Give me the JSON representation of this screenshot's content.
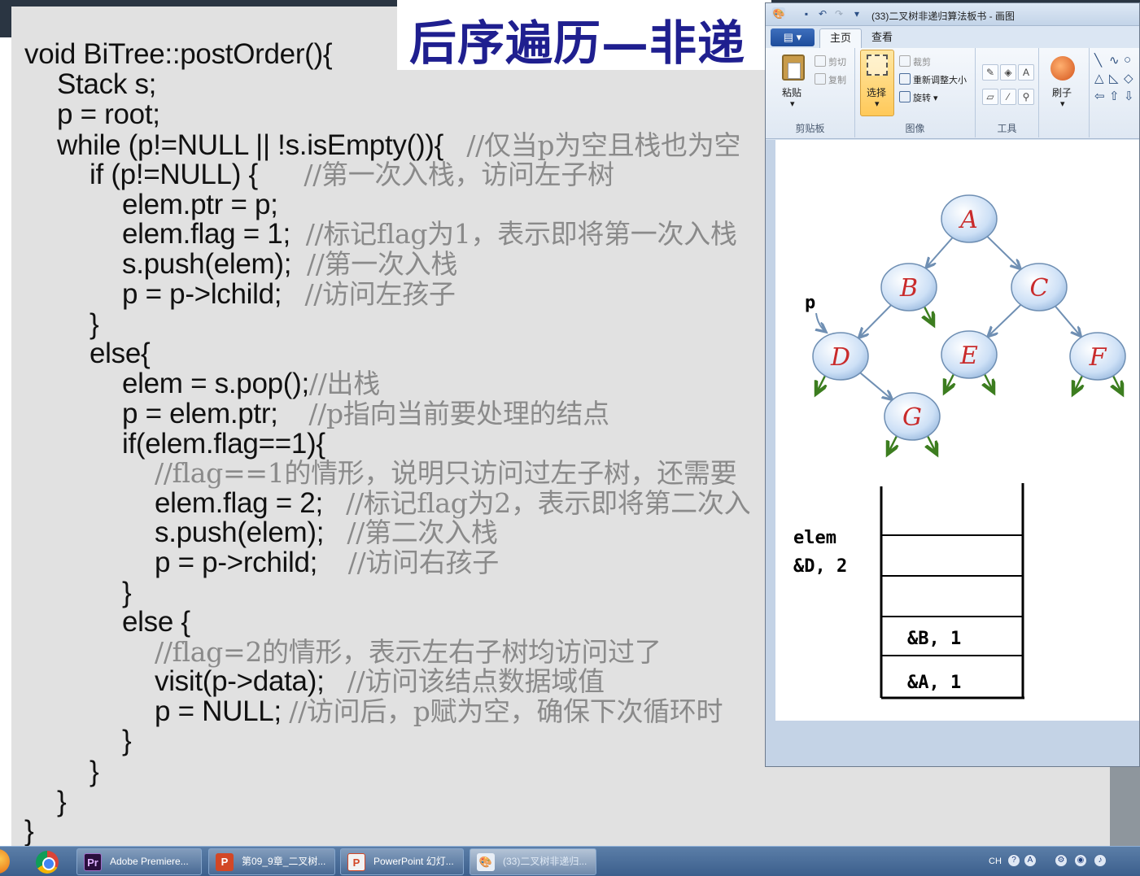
{
  "slide": {
    "title": "后序遍历—非递",
    "code_lines": [
      {
        "code": "void BiTree::postOrder(){",
        "comment": ""
      },
      {
        "code": "Stack s;",
        "comment": ""
      },
      {
        "code": "p = root;",
        "comment": ""
      },
      {
        "code": "while (p!=NULL || !s.isEmpty()){   ",
        "comment": "//仅当p为空且栈也为空"
      },
      {
        "code": "if (p!=NULL) {      ",
        "comment": "//第一次入栈，访问左子树"
      },
      {
        "code": "elem.ptr = p;",
        "comment": ""
      },
      {
        "code": "elem.flag = 1;  ",
        "comment": "//标记flag为1，表示即将第一次入栈"
      },
      {
        "code": "s.push(elem);  ",
        "comment": "//第一次入栈"
      },
      {
        "code": "p = p->lchild;   ",
        "comment": "//访问左孩子"
      },
      {
        "code": "}",
        "comment": ""
      },
      {
        "code": "else{",
        "comment": ""
      },
      {
        "code": "elem = s.pop();",
        "comment": "//出栈"
      },
      {
        "code": "p = elem.ptr;    ",
        "comment": "//p指向当前要处理的结点"
      },
      {
        "code": "if(elem.flag==1){",
        "comment": ""
      },
      {
        "code": "",
        "comment": "//flag==1的情形，说明只访问过左子树，还需要"
      },
      {
        "code": "elem.flag = 2;   ",
        "comment": "//标记flag为2，表示即将第二次入"
      },
      {
        "code": "s.push(elem);   ",
        "comment": "//第二次入栈"
      },
      {
        "code": "p = p->rchild;    ",
        "comment": "//访问右孩子"
      },
      {
        "code": "}",
        "comment": ""
      },
      {
        "code": "else {",
        "comment": ""
      },
      {
        "code": "",
        "comment": "//flag=2的情形，表示左右子树均访问过了"
      },
      {
        "code": "visit(p->data);   ",
        "comment": "//访问该结点数据域值"
      },
      {
        "code": "p = NULL; ",
        "comment": "//访问后，p赋为空，确保下次循环时"
      },
      {
        "code": "}",
        "comment": ""
      },
      {
        "code": "}",
        "comment": ""
      },
      {
        "code": "}",
        "comment": ""
      },
      {
        "code": "}",
        "comment": ""
      }
    ]
  },
  "paint": {
    "window_title": "(33)二叉树非递归算法板书 - 画图",
    "tabs": [
      "主页",
      "查看"
    ],
    "clipboard": {
      "paste": "粘贴",
      "cut": "剪切",
      "copy": "复制",
      "caption": "剪贴板"
    },
    "image_group": {
      "select": "选择",
      "crop": "裁剪",
      "resize": "重新调整大小",
      "rotate": "旋转",
      "caption": "图像"
    },
    "tools_caption": "工具",
    "brush_label": "刷子",
    "tree_nodes": [
      "A",
      "B",
      "C",
      "D",
      "E",
      "F",
      "G"
    ],
    "pointer_label": "p",
    "elem_label": "elem",
    "elem_value": "&D, 2",
    "stack_items": [
      "&B, 1",
      "&A, 1"
    ]
  },
  "taskbar": {
    "buttons": [
      {
        "label": "Adobe Premiere...",
        "icon": "Pr"
      },
      {
        "label": "第09_9章_二叉树...",
        "icon": "P"
      },
      {
        "label": "PowerPoint 幻灯...",
        "icon": "P"
      },
      {
        "label": "(33)二叉树非递归...",
        "icon": "paint"
      }
    ],
    "ime": "CH"
  },
  "colors": {
    "node_fill": "#cde0f6",
    "node_letter": "#c92b2b",
    "edge": "#6f8fb3",
    "null_arrow": "#3c7d1f",
    "title": "#1f1f8f"
  }
}
